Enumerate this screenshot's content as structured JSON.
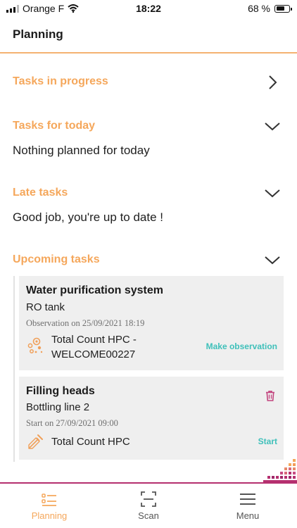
{
  "status_bar": {
    "carrier": "Orange F",
    "time": "18:22",
    "battery": "68 %",
    "battery_level": 0.68
  },
  "header": {
    "title": "Planning"
  },
  "sections": {
    "in_progress": {
      "label": "Tasks in progress"
    },
    "today": {
      "label": "Tasks for today",
      "message": "Nothing planned for today"
    },
    "late": {
      "label": "Late tasks",
      "message": "Good job, you're up to date !"
    },
    "upcoming": {
      "label": "Upcoming tasks"
    }
  },
  "cards": [
    {
      "name": "Water purification system",
      "location": "RO tank",
      "meta": "Observation on 25/09/2021 18:19",
      "test_line1": "Total Count HPC -",
      "test_line2": "WELCOME00227",
      "action": "Make observation",
      "icon": "observation-icon"
    },
    {
      "name": "Filling heads",
      "location": "Bottling line 2",
      "meta": "Start on 27/09/2021 09:00",
      "test_line1": "Total Count HPC",
      "action": "Start",
      "icon": "pipette-icon"
    }
  ],
  "tabs": [
    {
      "label": "Planning",
      "icon": "planning-icon",
      "active": true
    },
    {
      "label": "Scan",
      "icon": "scan-icon",
      "active": false
    },
    {
      "label": "Menu",
      "icon": "menu-icon",
      "active": false
    }
  ],
  "colors": {
    "accent": "#f5a75b",
    "teal": "#3fc0ba",
    "magenta": "#b5306f",
    "card_bg": "#efefef"
  }
}
